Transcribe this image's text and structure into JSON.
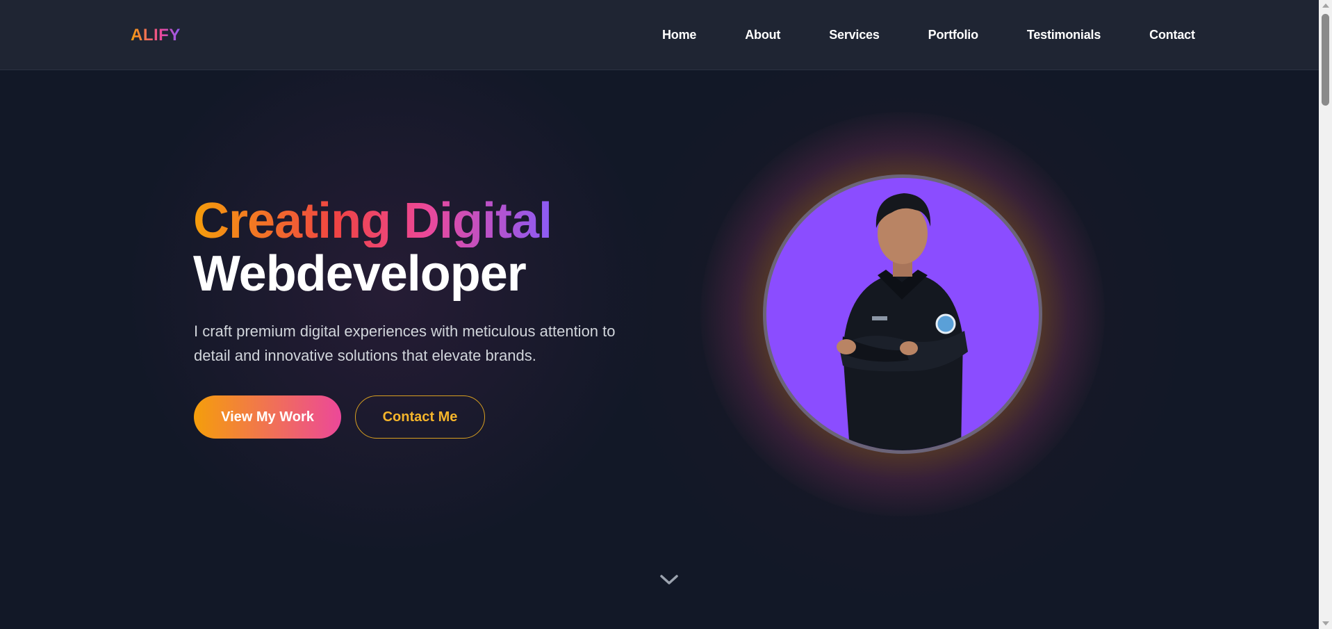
{
  "brand": {
    "logo": "ALIFY"
  },
  "nav": {
    "items": [
      {
        "label": "Home"
      },
      {
        "label": "About"
      },
      {
        "label": "Services"
      },
      {
        "label": "Portfolio"
      },
      {
        "label": "Testimonials"
      },
      {
        "label": "Contact"
      }
    ]
  },
  "hero": {
    "title_line1": "Creating Digital",
    "title_line2": "Webdeveloper",
    "description": "I craft premium digital experiences with meticulous attention to detail and innovative solutions that elevate brands.",
    "primary_button": "View My Work",
    "secondary_button": "Contact Me"
  },
  "icons": {
    "scroll_down": "chevron-down-icon"
  },
  "colors": {
    "background": "#121827",
    "navbar": "#1f2533",
    "accent_orange": "#f59e0b",
    "accent_pink": "#ec4899",
    "accent_purple": "#8b5cf6",
    "avatar_bg": "#8b4dff",
    "outline_button": "#f5b52b"
  }
}
